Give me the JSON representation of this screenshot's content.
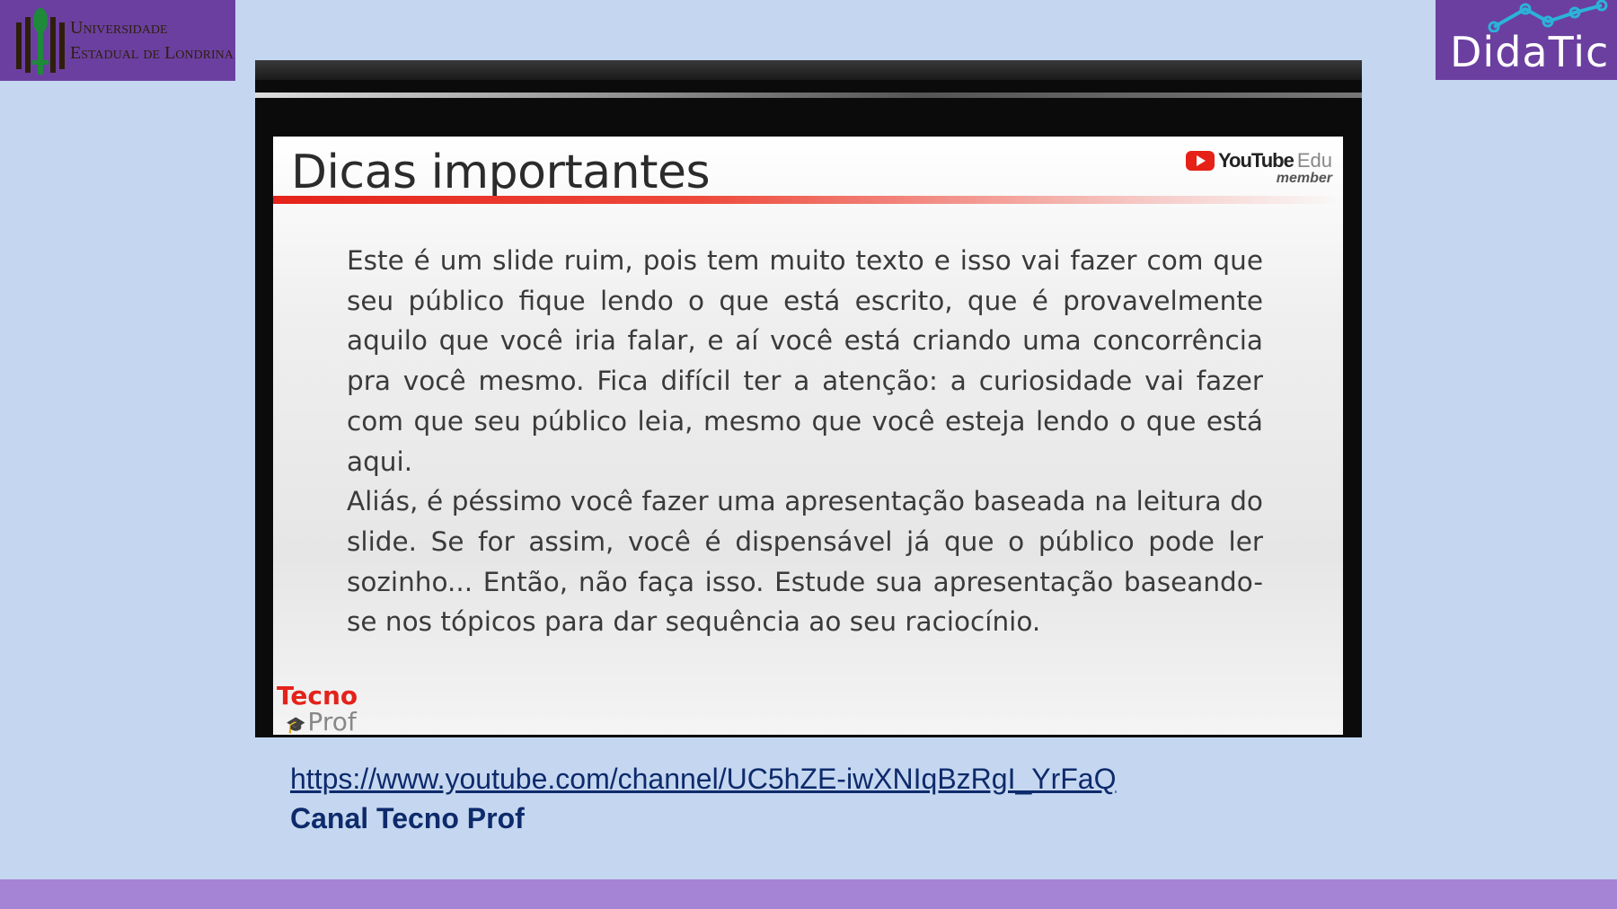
{
  "logos": {
    "uel_line1": "Universidade",
    "uel_line2": "Estadual de Londrina",
    "didatic": "DidaTic"
  },
  "slide": {
    "title": "Dicas importantes",
    "youtube_word": "YouTube",
    "youtube_edu": "Edu",
    "youtube_member": "member",
    "paragraph1": "Este é um slide ruim, pois tem muito texto e isso vai fazer com que seu público fique lendo o que está escrito, que é provavelmente aquilo que você iria falar, e aí você está criando uma concorrência pra você mesmo. Fica difícil ter a atenção: a curiosidade vai fazer com que seu público leia, mesmo que você esteja lendo o que está aqui.",
    "paragraph2": "Aliás, é péssimo você fazer uma apresentação baseada na leitura do slide. Se for assim, você é dispensável já que o público pode ler sozinho... Então, não faça isso. Estude sua apresentação baseando-se nos tópicos para dar sequência ao seu raciocínio.",
    "tecno_top": "Tecno",
    "tecno_bottom": "Prof"
  },
  "footer": {
    "link": "https://www.youtube.com/channel/UC5hZE-iwXNIqBzRgI_YrFaQ",
    "channel": "Canal Tecno Prof"
  },
  "colors": {
    "background": "#c5d7f0",
    "logo_purple": "#6b3fa0",
    "bottom_band": "#a584d6",
    "link_text": "#0d2a6b",
    "slide_red": "#e5231b"
  }
}
